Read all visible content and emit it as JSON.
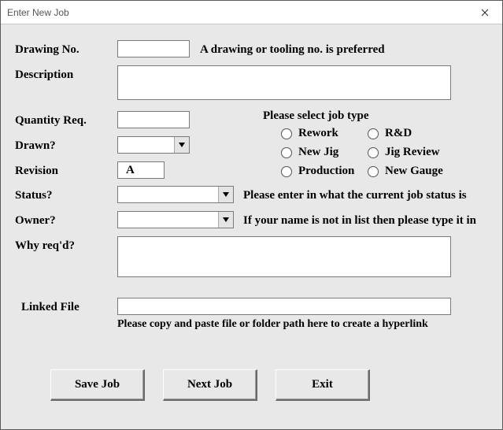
{
  "window": {
    "title": "Enter New Job"
  },
  "labels": {
    "drawing_no": "Drawing No.",
    "description": "Description",
    "quantity_req": "Quantity Req.",
    "drawn": "Drawn?",
    "revision": "Revision",
    "status": "Status?",
    "owner": "Owner?",
    "why_reqd": "Why req'd?",
    "linked_file": "Linked File"
  },
  "hints": {
    "drawing_hint": "A drawing or tooling no. is preferred",
    "jobtype_header": "Please select job type",
    "status_hint": "Please enter in what the current job status is",
    "owner_hint": "If your name is not in list then please type it in",
    "linked_hint": "Please copy and paste file or folder path here to create a hyperlink"
  },
  "fields": {
    "drawing_no": "",
    "description": "",
    "quantity_req": "",
    "drawn": "",
    "revision": "A",
    "status": "",
    "owner": "",
    "why_reqd": "",
    "linked_file": ""
  },
  "job_types": {
    "rework": "Rework",
    "rd": "R&D",
    "new_jig": "New Jig",
    "jig_review": "Jig Review",
    "production": "Production",
    "new_gauge": "New Gauge"
  },
  "buttons": {
    "save": "Save Job",
    "next": "Next Job",
    "exit": "Exit"
  }
}
